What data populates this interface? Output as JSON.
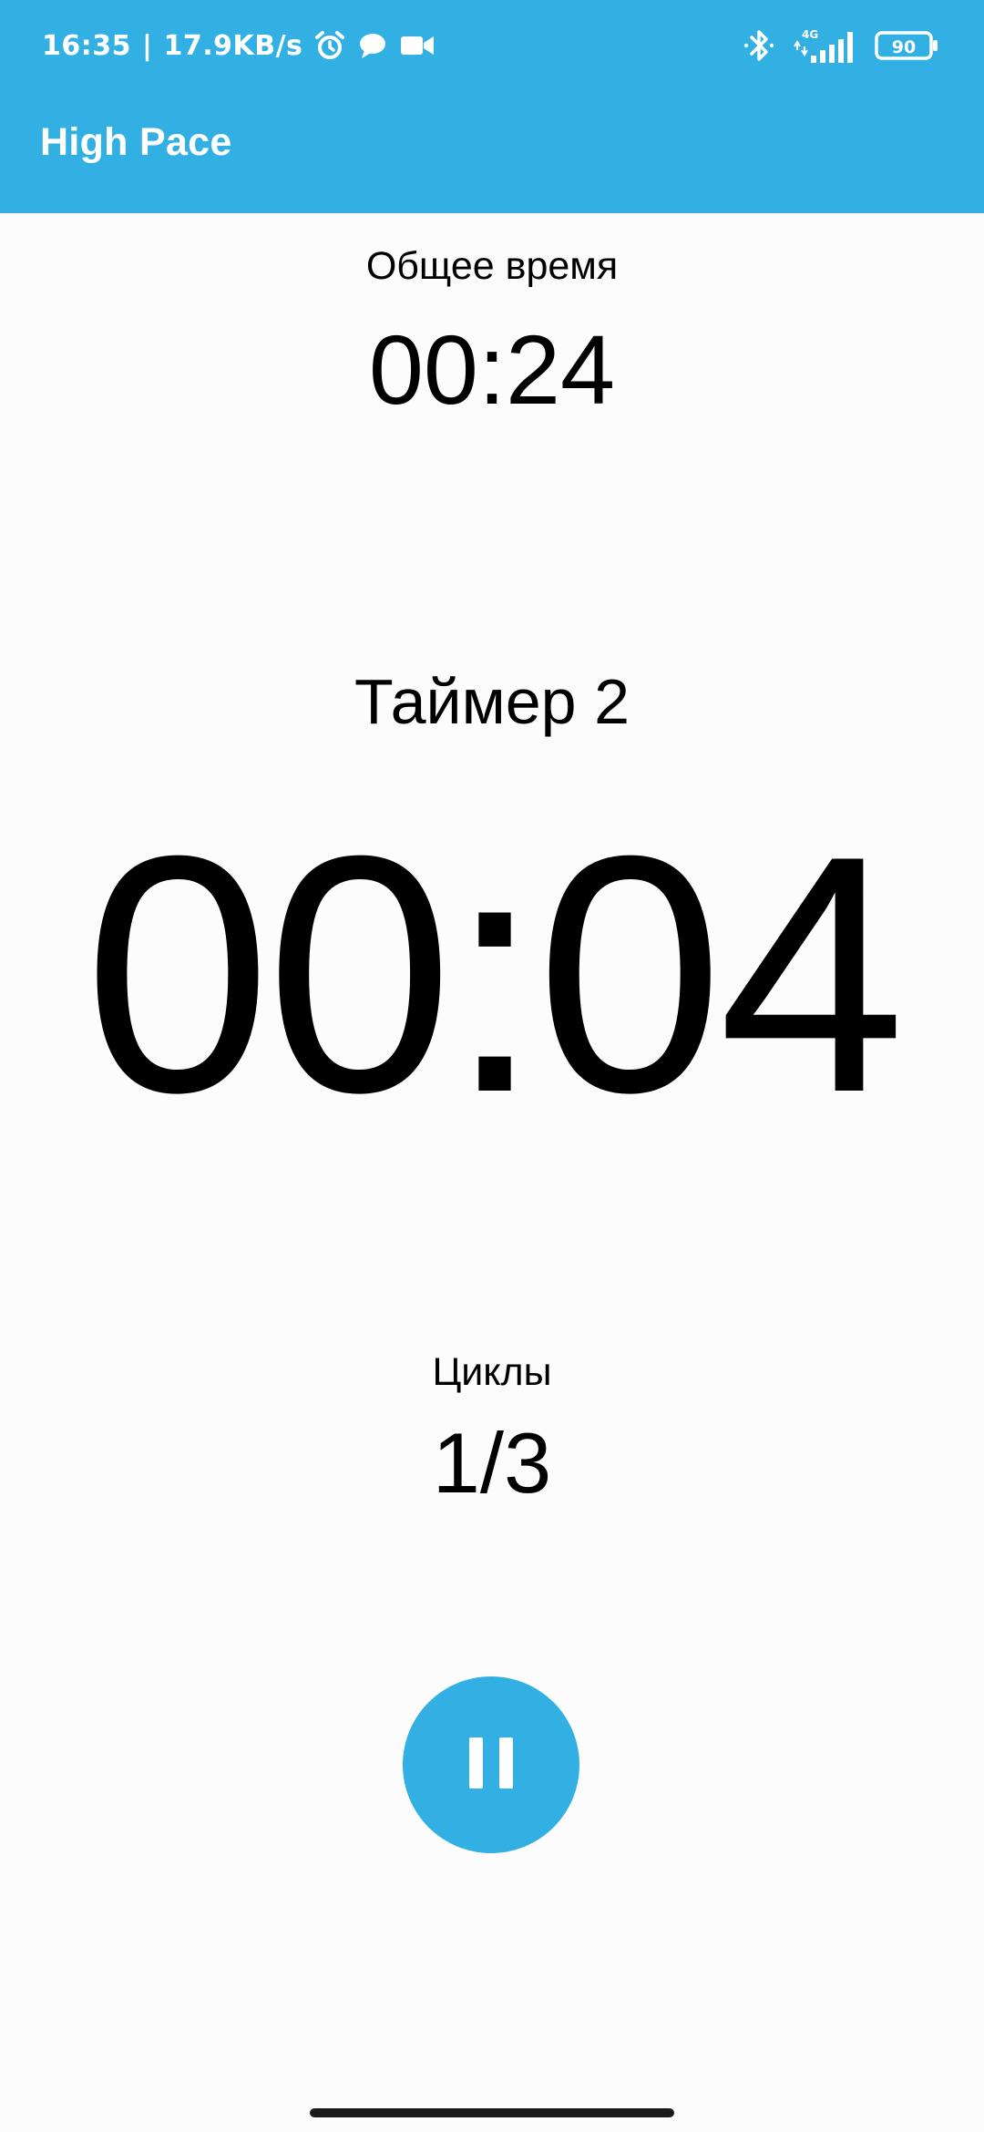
{
  "status_bar": {
    "time": "16:35",
    "separator": "|",
    "net_speed": "17.9KB/s",
    "network_type": "4G",
    "battery_level": "90",
    "icons": [
      "alarm-icon",
      "message-icon",
      "video-camera-icon",
      "bluetooth-icon",
      "signal-icon",
      "battery-icon"
    ]
  },
  "app_bar": {
    "title": "High Pace"
  },
  "total_time": {
    "label": "Общее время",
    "value": "00:24"
  },
  "timer": {
    "name": "Таймер 2",
    "value": "00:04"
  },
  "cycles": {
    "label": "Циклы",
    "value": "1/3"
  },
  "controls": {
    "pause_icon": "pause-icon"
  },
  "colors": {
    "accent": "#32b0e3",
    "text": "#000000",
    "background": "#fcfcfc",
    "on_accent": "#ffffff"
  }
}
